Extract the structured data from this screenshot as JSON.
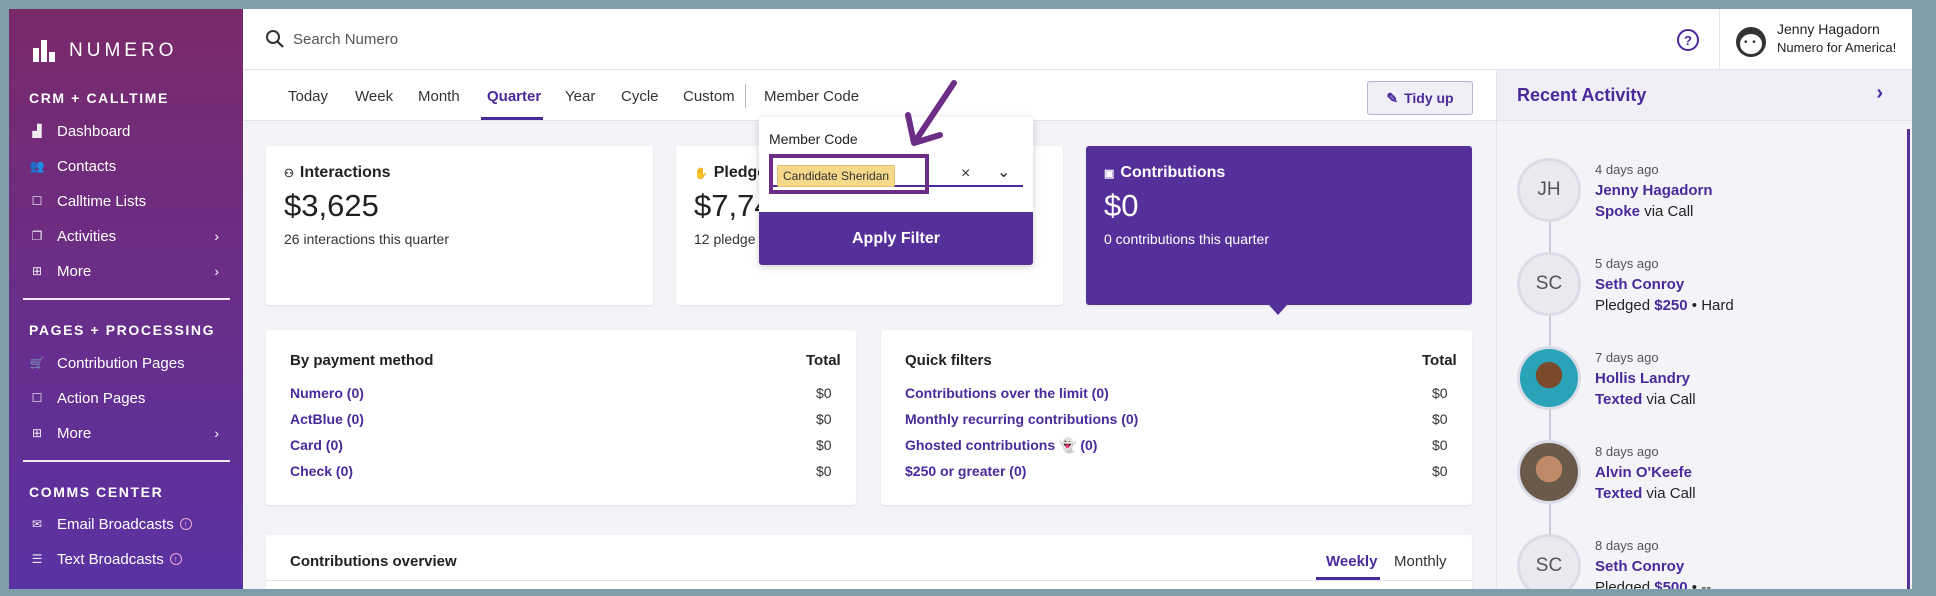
{
  "brand": {
    "name": "NUMERO"
  },
  "sidebar": {
    "sections": [
      {
        "title": "CRM + CALLTIME",
        "items": [
          {
            "label": "Dashboard",
            "icon": "chart-icon"
          },
          {
            "label": "Contacts",
            "icon": "people-icon"
          },
          {
            "label": "Calltime Lists",
            "icon": "phone-icon"
          },
          {
            "label": "Activities",
            "icon": "activities-icon",
            "chevron": true
          },
          {
            "label": "More",
            "icon": "more-icon",
            "chevron": true
          }
        ]
      },
      {
        "title": "PAGES + PROCESSING",
        "items": [
          {
            "label": "Contribution Pages",
            "icon": "cart-icon"
          },
          {
            "label": "Action Pages",
            "icon": "action-icon"
          },
          {
            "label": "More",
            "icon": "more-icon",
            "chevron": true
          }
        ]
      },
      {
        "title": "COMMS CENTER",
        "items": [
          {
            "label": "Email Broadcasts",
            "icon": "email-icon",
            "plus": true
          },
          {
            "label": "Text Broadcasts",
            "icon": "text-icon",
            "plus": true
          }
        ]
      }
    ]
  },
  "topbar": {
    "search_placeholder": "Search Numero",
    "help_label": "?",
    "user_name": "Jenny Hagadorn",
    "user_org": "Numero for America!"
  },
  "tabs": {
    "items": [
      "Today",
      "Week",
      "Month",
      "Quarter",
      "Year",
      "Cycle",
      "Custom"
    ],
    "active": "Quarter",
    "member_code": "Member Code",
    "tidy_label": "Tidy up"
  },
  "stats": {
    "interactions": {
      "title": "Interactions",
      "value": "$3,625",
      "sub": "26 interactions this quarter"
    },
    "pledges": {
      "title": "Pledges",
      "value": "$7,74",
      "sub": "12 pledge"
    },
    "contributions": {
      "title": "Contributions",
      "value": "$0",
      "sub": "0 contributions this quarter"
    }
  },
  "payment": {
    "title": "By payment method",
    "total_label": "Total",
    "rows": [
      {
        "label": "Numero (0)",
        "value": "$0"
      },
      {
        "label": "ActBlue (0)",
        "value": "$0"
      },
      {
        "label": "Card (0)",
        "value": "$0"
      },
      {
        "label": "Check (0)",
        "value": "$0"
      }
    ]
  },
  "quick": {
    "title": "Quick filters",
    "total_label": "Total",
    "rows": [
      {
        "label": "Contributions over the limit (0)",
        "value": "$0"
      },
      {
        "label": "Monthly recurring contributions (0)",
        "value": "$0"
      },
      {
        "label": "Ghosted contributions 👻 (0)",
        "value": "$0"
      },
      {
        "label": "$250 or greater (0)",
        "value": "$0"
      }
    ]
  },
  "overview": {
    "title": "Contributions overview",
    "tabs": [
      "Weekly",
      "Monthly"
    ],
    "active": "Weekly"
  },
  "popup": {
    "label": "Member Code",
    "chip": "Candidate Sheridan",
    "clear": "×",
    "apply": "Apply Filter"
  },
  "recent": {
    "title": "Recent Activity",
    "items": [
      {
        "initials": "JH",
        "time": "4 days ago",
        "name": "Jenny Hagadorn",
        "action": "Spoke",
        "detail": "via Call"
      },
      {
        "initials": "SC",
        "time": "5 days ago",
        "name": "Seth Conroy",
        "action": "Pledged",
        "amount": "$250",
        "detail": "• Hard"
      },
      {
        "initials": "",
        "time": "7 days ago",
        "name": "Hollis Landry",
        "action": "Texted",
        "detail": "via Call"
      },
      {
        "initials": "",
        "time": "8 days ago",
        "name": "Alvin O'Keefe",
        "action": "Texted",
        "detail": "via Call"
      },
      {
        "initials": "SC",
        "time": "8 days ago",
        "name": "Seth Conroy",
        "action": "Pledged",
        "amount": "$500",
        "detail": "• --"
      }
    ]
  }
}
